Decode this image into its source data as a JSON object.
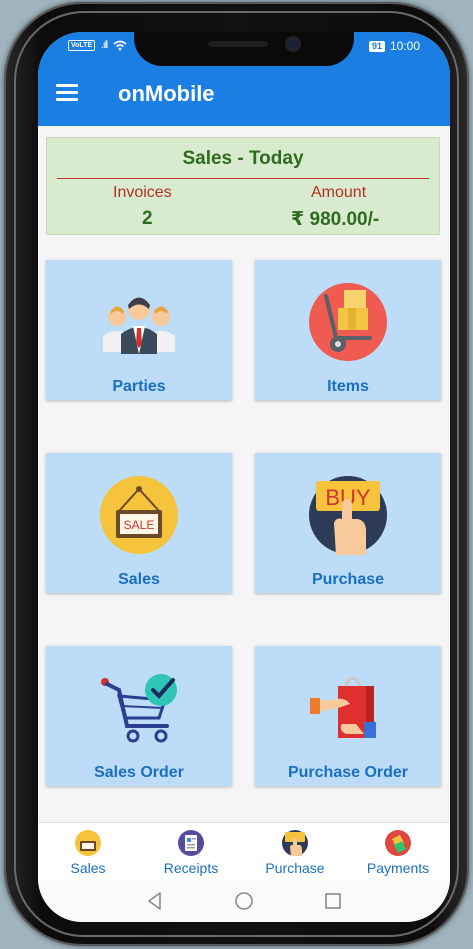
{
  "status_bar": {
    "network_badge": "VoLTE",
    "signal": ".ıll",
    "battery": "91",
    "time": "10:00"
  },
  "app_bar": {
    "title": "onMobile",
    "menu_icon": "menu-icon"
  },
  "summary": {
    "title": "Sales - Today",
    "invoices_label": "Invoices",
    "invoices_value": "2",
    "amount_label": "Amount",
    "amount_value": "₹ 980.00/-"
  },
  "tiles": [
    {
      "label": "Parties",
      "icon": "parties-icon"
    },
    {
      "label": "Items",
      "icon": "items-icon"
    },
    {
      "label": "Sales",
      "icon": "sale-sign-icon"
    },
    {
      "label": "Purchase",
      "icon": "buy-icon"
    },
    {
      "label": "Sales Order",
      "icon": "cart-check-icon"
    },
    {
      "label": "Purchase Order",
      "icon": "shopping-bag-icon"
    }
  ],
  "bottom_nav": [
    {
      "label": "Sales",
      "icon": "sales-nav-icon"
    },
    {
      "label": "Receipts",
      "icon": "receipts-nav-icon"
    },
    {
      "label": "Purchase",
      "icon": "purchase-nav-icon"
    },
    {
      "label": "Payments",
      "icon": "payments-nav-icon"
    }
  ],
  "colors": {
    "primary": "#1a7ee2",
    "tile_bg": "#bcdcf8",
    "summary_bg": "#d9ebcf",
    "summary_green": "#2f6b20",
    "summary_red": "#b03025"
  }
}
